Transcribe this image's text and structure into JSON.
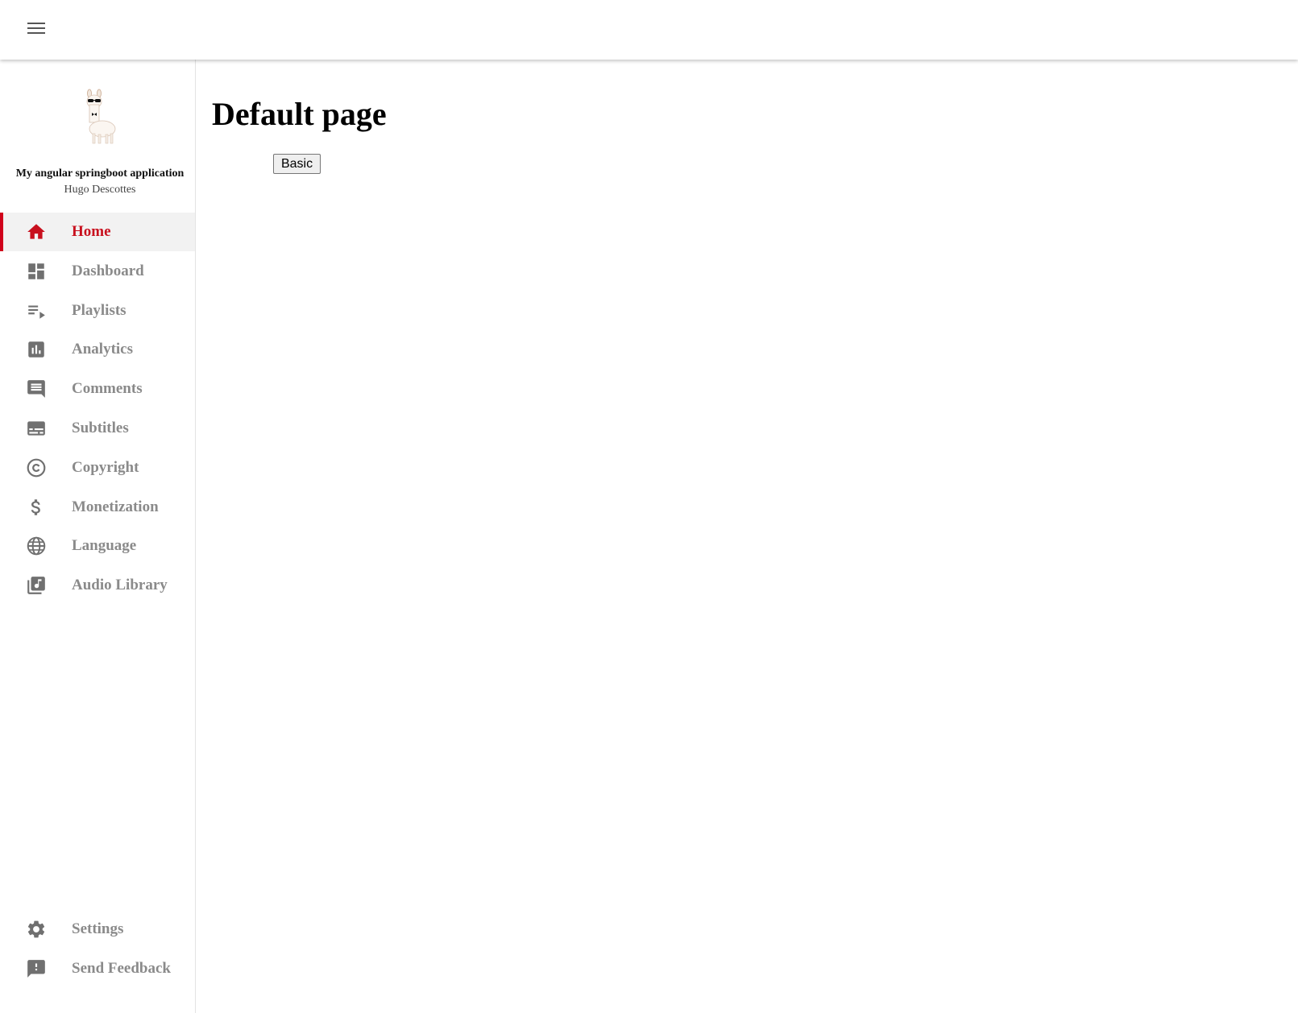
{
  "topbar": {
    "menu_icon": "hamburger-menu-icon"
  },
  "profile": {
    "avatar_icon": "llama-with-sunglasses-avatar",
    "app_title": "My angular springboot application",
    "author": "Hugo Descottes"
  },
  "sidebar": {
    "items": [
      {
        "label": "Home",
        "icon": "home-icon",
        "active": true
      },
      {
        "label": "Dashboard",
        "icon": "dashboard-icon"
      },
      {
        "label": "Playlists",
        "icon": "playlist-icon"
      },
      {
        "label": "Analytics",
        "icon": "analytics-icon"
      },
      {
        "label": "Comments",
        "icon": "comment-icon"
      },
      {
        "label": "Subtitles",
        "icon": "subtitles-icon"
      },
      {
        "label": "Copyright",
        "icon": "copyright-icon"
      },
      {
        "label": "Monetization",
        "icon": "dollar-icon"
      },
      {
        "label": "Language",
        "icon": "globe-icon"
      },
      {
        "label": "Audio Library",
        "icon": "music-library-icon"
      }
    ],
    "bottom_items": [
      {
        "label": "Settings",
        "icon": "gear-icon"
      },
      {
        "label": "Send Feedback",
        "icon": "feedback-icon"
      }
    ]
  },
  "main": {
    "title": "Default page",
    "basic_button": "Basic"
  },
  "colors": {
    "accent": "#c8101e",
    "nav_text": "#8a8a8a",
    "active_bg": "#f2f2f2"
  }
}
